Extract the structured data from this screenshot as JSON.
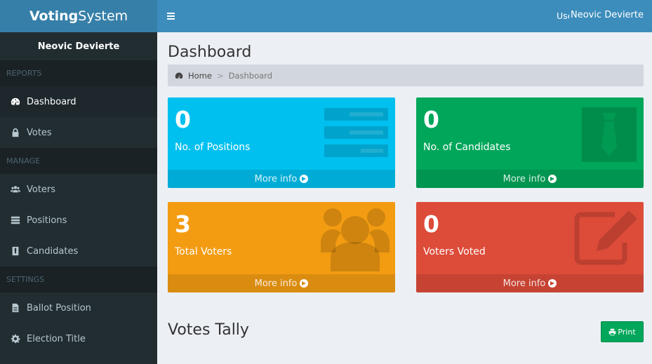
{
  "app": {
    "logo_bold": "Voting",
    "logo_rest": "System"
  },
  "navbar": {
    "user_label": "User",
    "user_name": "Neovic Devierte"
  },
  "sidebar": {
    "user_name": "Neovic Devierte",
    "sections": [
      {
        "header": "REPORTS",
        "items": [
          {
            "label": "Dashboard",
            "icon": "dashboard-icon",
            "active": true
          },
          {
            "label": "Votes",
            "icon": "lock-icon"
          }
        ]
      },
      {
        "header": "MANAGE",
        "items": [
          {
            "label": "Voters",
            "icon": "users-icon"
          },
          {
            "label": "Positions",
            "icon": "tasks-icon"
          },
          {
            "label": "Candidates",
            "icon": "candidate-icon"
          }
        ]
      },
      {
        "header": "SETTINGS",
        "items": [
          {
            "label": "Ballot Position",
            "icon": "file-icon"
          },
          {
            "label": "Election Title",
            "icon": "gear-icon"
          }
        ]
      }
    ]
  },
  "page": {
    "title": "Dashboard",
    "breadcrumb_home": "Home",
    "breadcrumb_current": "Dashboard"
  },
  "boxes": [
    {
      "value": "0",
      "label": "No. of Positions",
      "footer": "More info",
      "color": "#00c0ef"
    },
    {
      "value": "0",
      "label": "No. of Candidates",
      "footer": "More info",
      "color": "#00a65a"
    },
    {
      "value": "3",
      "label": "Total Voters",
      "footer": "More info",
      "color": "#f39c12"
    },
    {
      "value": "0",
      "label": "Voters Voted",
      "footer": "More info",
      "color": "#dd4b39"
    }
  ],
  "tally": {
    "title": "Votes Tally",
    "print_label": "Print"
  }
}
